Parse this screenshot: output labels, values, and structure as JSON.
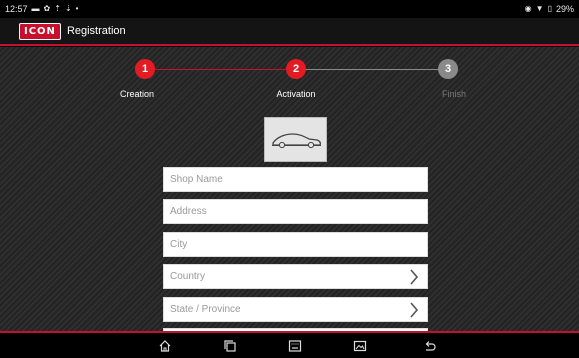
{
  "status_bar": {
    "time": "12:57",
    "battery": "29%",
    "left_icons": [
      "notification-icon",
      "settings-icon",
      "upload-icon",
      "download-icon",
      "dot-icon"
    ],
    "right_icons": [
      "location-icon",
      "wifi-icon",
      "battery-icon"
    ]
  },
  "app_bar": {
    "logo_text": "ICON",
    "title": "Registration"
  },
  "stepper": {
    "steps": [
      {
        "number": "1",
        "label": "Creation",
        "state": "done"
      },
      {
        "number": "2",
        "label": "Activation",
        "state": "active"
      },
      {
        "number": "3",
        "label": "Finish",
        "state": "pending"
      }
    ]
  },
  "vehicle_image": {
    "icon": "car-silhouette-icon"
  },
  "form": {
    "fields": [
      {
        "placeholder": "Shop Name",
        "type": "text"
      },
      {
        "placeholder": "Address",
        "type": "text"
      },
      {
        "placeholder": "City",
        "type": "text"
      },
      {
        "placeholder": "Country",
        "type": "select"
      },
      {
        "placeholder": "State / Province",
        "type": "select"
      }
    ]
  },
  "nav_bar": {
    "buttons": [
      "home-icon",
      "recent-apps-icon",
      "keyboard-icon",
      "screenshot-icon",
      "back-icon"
    ]
  },
  "colors": {
    "accent": "#c8102e",
    "step_active": "#e31b23",
    "step_pending": "#8a8a8a",
    "background": "#262626"
  }
}
